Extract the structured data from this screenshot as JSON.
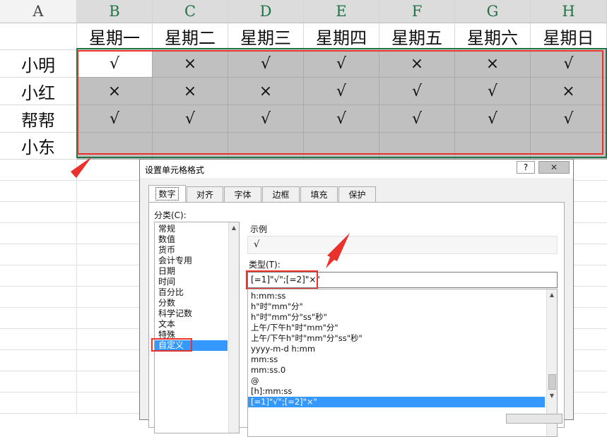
{
  "sheet": {
    "column_headers": [
      "A",
      "B",
      "C",
      "D",
      "E",
      "F",
      "G",
      "H"
    ],
    "weekdays": [
      "星期一",
      "星期二",
      "星期三",
      "星期四",
      "星期五",
      "星期六",
      "星期日"
    ],
    "rows": [
      {
        "name": "小明",
        "marks": [
          "√",
          "×",
          "√",
          "√",
          "×",
          "×",
          "√"
        ]
      },
      {
        "name": "小红",
        "marks": [
          "×",
          "×",
          "×",
          "√",
          "√",
          "√",
          "×"
        ]
      },
      {
        "name": "帮帮",
        "marks": [
          "√",
          "√",
          "√",
          "√",
          "√",
          "√",
          "√"
        ]
      },
      {
        "name": "小东",
        "marks": [
          "",
          "",
          "",
          "",
          "",
          "",
          ""
        ]
      }
    ],
    "highlight_color": "#e8322b",
    "selection_color": "#217346"
  },
  "dialog": {
    "title": "设置单元格格式",
    "help_label": "?",
    "close_label": "✕",
    "tabs": [
      "数字",
      "对齐",
      "字体",
      "边框",
      "填充",
      "保护"
    ],
    "active_tab": "数字",
    "category_label": "分类(C):",
    "categories": [
      "常规",
      "数值",
      "货币",
      "会计专用",
      "日期",
      "时间",
      "百分比",
      "分数",
      "科学记数",
      "文本",
      "特殊",
      "自定义"
    ],
    "selected_category": "自定义",
    "sample_label": "示例",
    "sample_value": "√",
    "type_label": "类型(T):",
    "type_value": "[=1]\"√\";[=2]\"×\"",
    "format_list": [
      "h:mm:ss",
      "h\"时\"mm\"分\"",
      "h\"时\"mm\"分\"ss\"秒\"",
      "上午/下午h\"时\"mm\"分\"",
      "上午/下午h\"时\"mm\"分\"ss\"秒\"",
      "yyyy-m-d h:mm",
      "mm:ss",
      "mm:ss.0",
      "@",
      "[h]:mm:ss",
      "[=1]\"√\";[=2]\"×\""
    ],
    "selected_format": "[=1]\"√\";[=2]\"×\""
  }
}
